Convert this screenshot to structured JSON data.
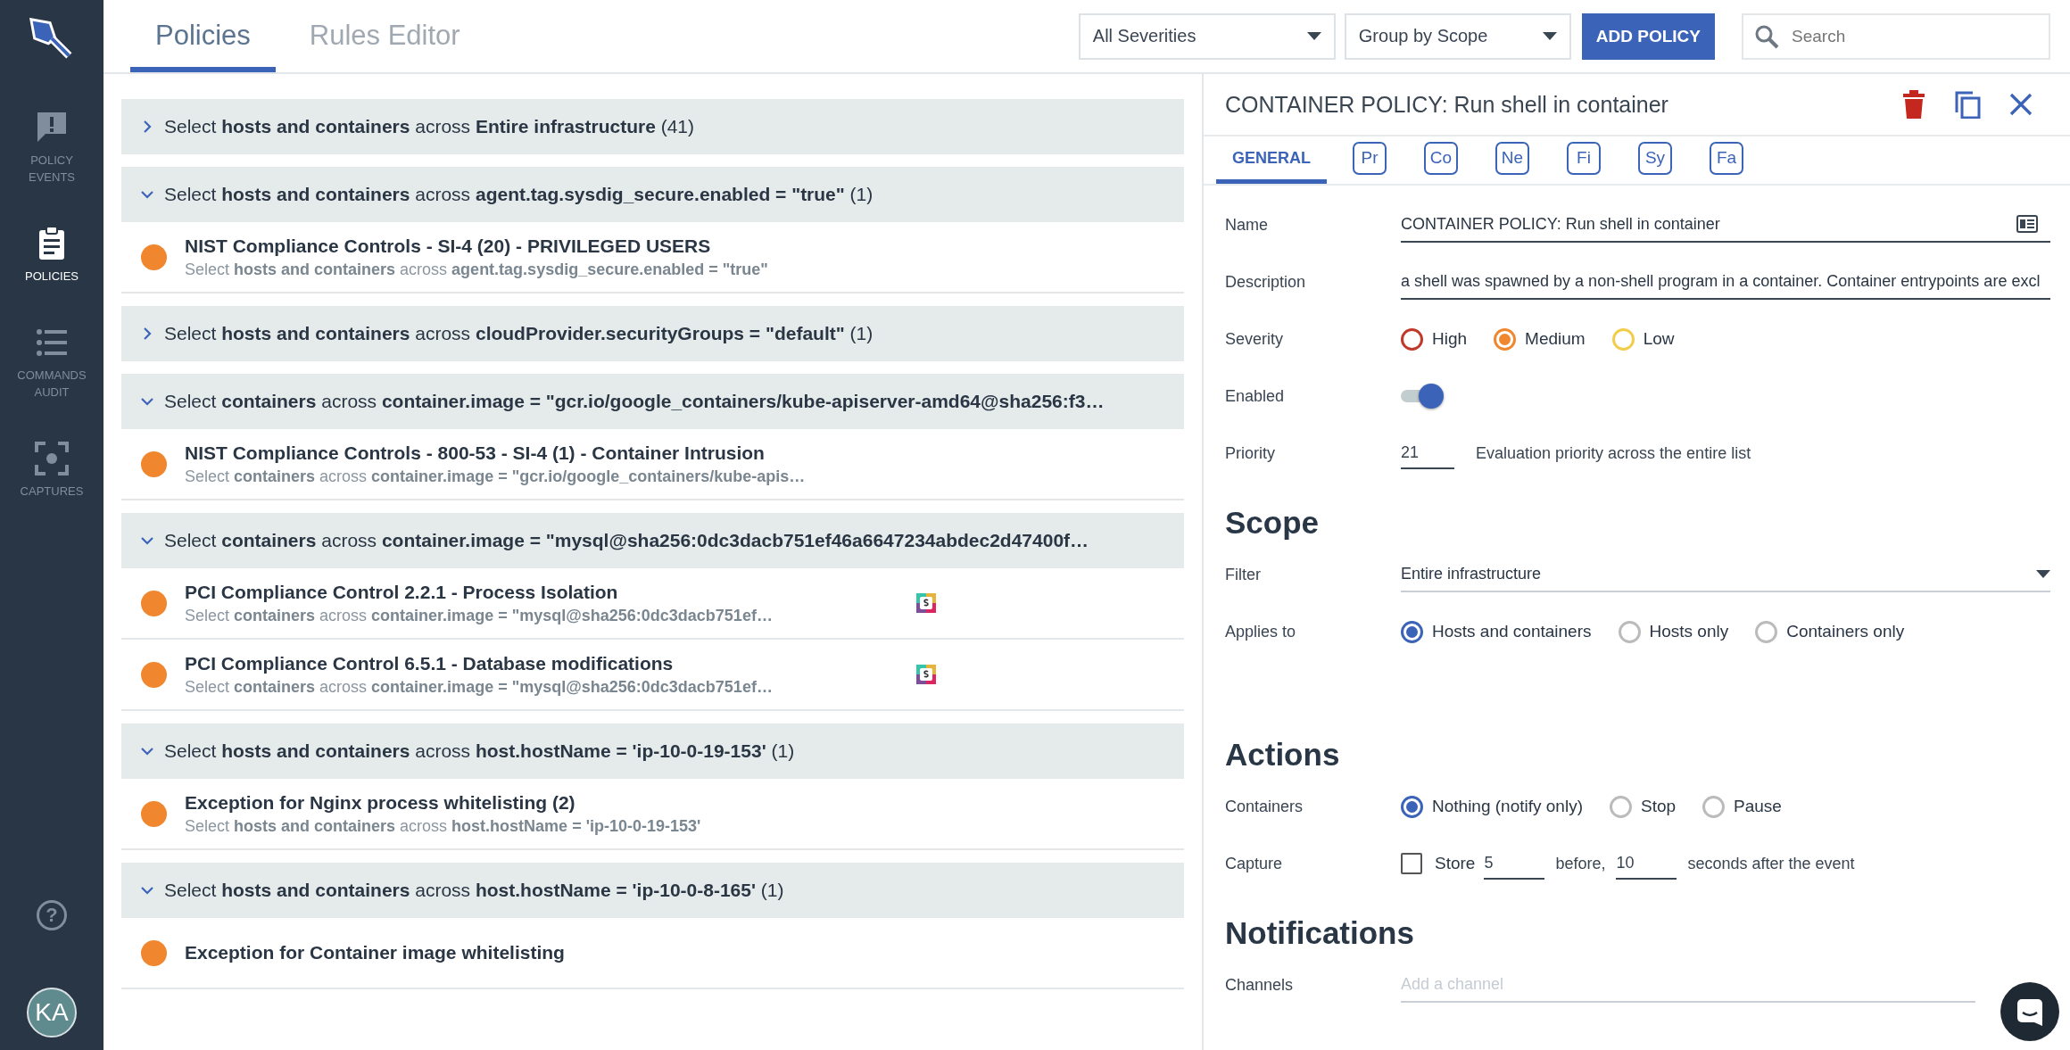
{
  "sidebar": {
    "nav": [
      {
        "label": "POLICY EVENTS",
        "selected": false
      },
      {
        "label": "POLICIES",
        "selected": true
      },
      {
        "label": "COMMANDS AUDIT",
        "selected": false
      },
      {
        "label": "CAPTURES",
        "selected": false
      }
    ],
    "help": "?",
    "avatar": "KA"
  },
  "header": {
    "tabs": [
      {
        "label": "Policies",
        "selected": true
      },
      {
        "label": "Rules Editor",
        "selected": false
      }
    ],
    "severity_filter": "All Severities",
    "grouping": "Group by Scope",
    "add_button": "ADD POLICY",
    "search": {
      "placeholder": "Search"
    }
  },
  "groups": [
    {
      "expanded": false,
      "text": "Select **hosts and containers** across **Entire infrastructure** (41)"
    },
    {
      "expanded": true,
      "text": "Select **hosts and containers** across **agent.tag.sysdig_secure.enabled = \"true\"** (1)",
      "policies": [
        {
          "title": "NIST Compliance Controls - SI-4 (20) - PRIVILEGED USERS",
          "scope": "Select **hosts and containers** across **agent.tag.sysdig_secure.enabled = \"true\"**",
          "color": "#f0862e",
          "channel": false
        }
      ]
    },
    {
      "expanded": false,
      "text": "Select **hosts and containers** across **cloudProvider.securityGroups = \"default\"** (1)"
    },
    {
      "expanded": true,
      "text": "Select **containers** across **container.image = \"gcr.io/google_containers/kube-apiserver-amd64@sha256:f3…**",
      "policies": [
        {
          "title": "NIST Compliance Controls - 800-53 - SI-4 (1) - Container Intrusion",
          "scope": "Select **containers** across **container.image = \"gcr.io/google_containers/kube-apis…**",
          "color": "#f0862e",
          "channel": false
        }
      ]
    },
    {
      "expanded": true,
      "text": "Select **containers** across **container.image = \"mysql@sha256:0dc3dacb751ef46a6647234abdec2d47400f…**",
      "policies": [
        {
          "title": "PCI Compliance Control 2.2.1 - Process Isolation",
          "scope": "Select **containers** across **container.image = \"mysql@sha256:0dc3dacb751ef…**",
          "color": "#f0862e",
          "channel": true
        },
        {
          "title": "PCI Compliance Control 6.5.1 - Database modifications",
          "scope": "Select **containers** across **container.image = \"mysql@sha256:0dc3dacb751ef…**",
          "color": "#f0862e",
          "channel": true
        }
      ]
    },
    {
      "expanded": true,
      "text": "Select **hosts and containers** across **host.hostName = 'ip-10-0-19-153'** (1)",
      "policies": [
        {
          "title": "Exception for Nginx process whitelisting (2)",
          "scope": "Select **hosts and containers** across **host.hostName = 'ip-10-0-19-153'**",
          "color": "#f0862e",
          "channel": false
        }
      ]
    },
    {
      "expanded": true,
      "text": "Select **hosts and containers** across **host.hostName = 'ip-10-0-8-165'** (1)",
      "policies": [
        {
          "title": "Exception for Container image whitelisting",
          "color": "#f0862e",
          "channel": false
        }
      ]
    }
  ],
  "detail": {
    "title": "CONTAINER POLICY: Run shell in container",
    "tabs": [
      {
        "label": "GENERAL",
        "kind": "text",
        "selected": true
      },
      {
        "label": "Pr",
        "kind": "badge",
        "selected": false
      },
      {
        "label": "Co",
        "kind": "badge",
        "selected": false
      },
      {
        "label": "Ne",
        "kind": "badge",
        "selected": false
      },
      {
        "label": "Fi",
        "kind": "badge",
        "selected": false
      },
      {
        "label": "Sy",
        "kind": "badge",
        "selected": false
      },
      {
        "label": "Fa",
        "kind": "badge",
        "selected": false
      }
    ],
    "name": {
      "label": "Name",
      "value": "CONTAINER POLICY: Run shell in container"
    },
    "description": {
      "label": "Description",
      "value": "a shell was spawned by a non-shell program in a container. Container entrypoints are excl"
    },
    "severity": {
      "label": "Severity",
      "options": [
        {
          "label": "High",
          "color": "#c0392b",
          "selected": false
        },
        {
          "label": "Medium",
          "color": "#f0862e",
          "selected": true
        },
        {
          "label": "Low",
          "color": "#f2cd4a",
          "selected": false
        }
      ]
    },
    "enabled": {
      "label": "Enabled",
      "on": true
    },
    "priority": {
      "label": "Priority",
      "value": "21",
      "hint": "Evaluation priority across the entire list"
    },
    "scope": {
      "heading": "Scope",
      "filter": {
        "label": "Filter",
        "value": "Entire infrastructure"
      },
      "applies_to": {
        "label": "Applies to",
        "options": [
          {
            "label": "Hosts and containers",
            "selected": true
          },
          {
            "label": "Hosts only",
            "selected": false
          },
          {
            "label": "Containers only",
            "selected": false
          }
        ]
      }
    },
    "actions": {
      "heading": "Actions",
      "containers": {
        "label": "Containers",
        "options": [
          {
            "label": "Nothing (notify only)",
            "selected": true
          },
          {
            "label": "Stop",
            "selected": false
          },
          {
            "label": "Pause",
            "selected": false
          }
        ]
      },
      "capture": {
        "label": "Capture",
        "checked": false,
        "store_label": "Store",
        "before": "5",
        "before_label": "before,",
        "after": "10",
        "after_label": "seconds after the event"
      }
    },
    "notifications": {
      "heading": "Notifications",
      "channels": {
        "label": "Channels",
        "placeholder": "Add a channel"
      }
    }
  }
}
